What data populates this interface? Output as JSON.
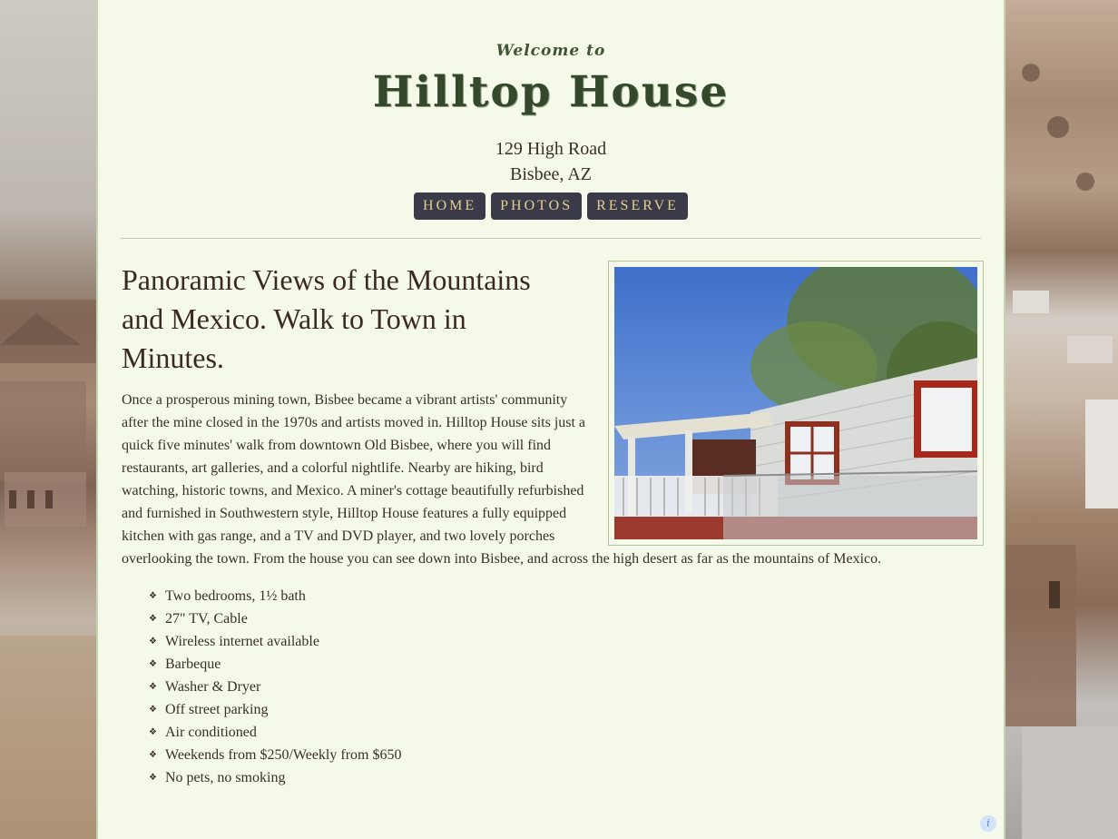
{
  "header": {
    "welcome": "Welcome to",
    "title": "Hilltop House",
    "address_line1": "129 High Road",
    "address_line2": "Bisbee, AZ"
  },
  "nav": {
    "items": [
      {
        "label": "HOME"
      },
      {
        "label": "PHOTOS"
      },
      {
        "label": "RESERVE"
      }
    ]
  },
  "main": {
    "headline": "Panoramic Views of the Mountains and Mexico. Walk to Town in Minutes.",
    "intro": "Once a prosperous mining town, Bisbee became a vibrant artists' community after the mine closed in the 1970s and artists moved in. Hilltop House sits just a quick five minutes' walk from downtown Old Bisbee, where you will find restaurants, art galleries, and a colorful nightlife. Nearby are hiking, bird watching, historic towns, and Mexico. A miner's cottage beautifully refurbished and furnished in Southwestern style, Hilltop House features a fully equipped kitchen with gas range, and a TV and DVD player, and two lovely porches overlooking the town. From the house you can see down into Bisbee, and across the high desert as far as the mountains of Mexico.",
    "amenities": [
      "Two bedrooms, 1½ bath",
      "27\" TV, Cable",
      "Wireless internet available",
      "Barbeque",
      "Washer & Dryer",
      "Off street parking",
      "Air conditioned",
      "Weekends from $250/Weekly from $650",
      "No pets, no smoking"
    ]
  },
  "colors": {
    "page_bg": "#f4f9ea",
    "nav_bg": "#3a3a48",
    "nav_text": "#e3cf8f",
    "title": "#34482b"
  }
}
